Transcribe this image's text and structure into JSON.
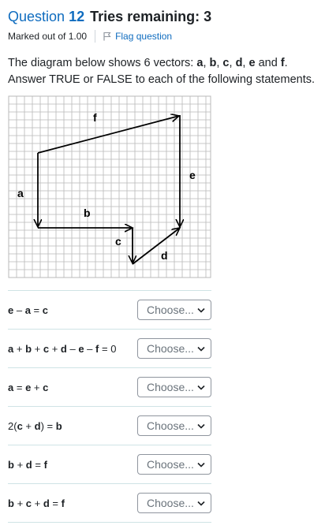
{
  "question": {
    "label": "Question",
    "number": "12",
    "tries": "Tries remaining: 3",
    "marked": "Marked out of 1.00",
    "flag_label": "Flag question"
  },
  "prompt": {
    "line1_prefix": "The diagram below shows 6 vectors: ",
    "v_a": "a",
    "v_b": "b",
    "v_c": "c",
    "v_d": "d",
    "v_e": "e",
    "v_f": "f",
    "and": " and ",
    "period": ".",
    "line2": "Answer TRUE or FALSE to each of the following statements."
  },
  "diagram": {
    "vector_labels": {
      "a": "a",
      "b": "b",
      "c": "c",
      "d": "d",
      "e": "e",
      "f": "f"
    },
    "grid_color": "#b8b8b8",
    "vector_color": "#000000"
  },
  "statements": [
    {
      "text": "e – a = c",
      "choice": "Choose..."
    },
    {
      "text": "a + b + c + d – e – f = 0",
      "choice": "Choose..."
    },
    {
      "text": "a = e + c",
      "choice": "Choose..."
    },
    {
      "text": "2(c + d) = b",
      "choice": "Choose..."
    },
    {
      "text": "b + d = f",
      "choice": "Choose..."
    },
    {
      "text": "b + c + d = f",
      "choice": "Choose..."
    }
  ],
  "colors": {
    "accent": "#0f6cbf",
    "divider": "#cfe3e5"
  }
}
